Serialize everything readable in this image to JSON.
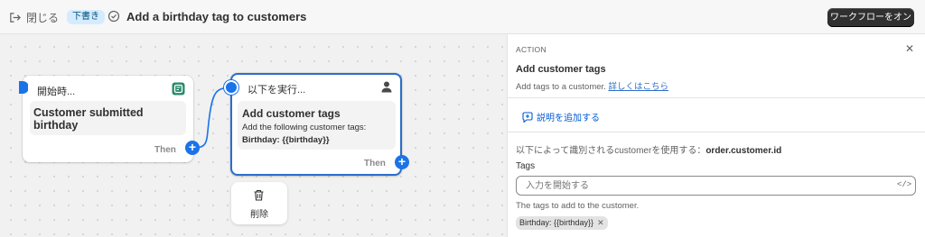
{
  "header": {
    "close_label": "閉じる",
    "draft_badge": "下書き",
    "title": "Add a birthday tag to customers",
    "turn_on_button": "ワークフローをオン"
  },
  "canvas": {
    "trigger": {
      "header_label": "開始時...",
      "title": "Customer submitted birthday",
      "then_label": "Then"
    },
    "action": {
      "header_label": "以下を実行...",
      "title": "Add customer tags",
      "description": "Add the following customer tags:",
      "tag": "Birthday: {{birthday}}",
      "then_label": "Then"
    },
    "delete_label": "削除"
  },
  "panel": {
    "section_label": "ACTION",
    "title": "Add customer tags",
    "subtitle": "Add tags to a customer.",
    "learn_more": "詳しくはこちら",
    "add_description": "説明を追加する",
    "used_customer_text": "以下によって識別されるcustomerを使用する：",
    "used_customer_value": "order.customer.id",
    "tags_label": "Tags",
    "tags_placeholder": "入力を開始する",
    "tags_help": "The tags to add to the customer.",
    "chips": [
      "Birthday: {{birthday}}"
    ]
  },
  "colors": {
    "accent": "#1a73e8",
    "primary_button": "#303030",
    "draft_badge_bg": "#d5ebff",
    "link": "#2c6ecb"
  },
  "icons": [
    "exit-icon",
    "status-check-icon",
    "shopify-flow-icon",
    "person-icon",
    "trash-icon",
    "comment-plus-icon",
    "code-icon",
    "close-icon"
  ]
}
